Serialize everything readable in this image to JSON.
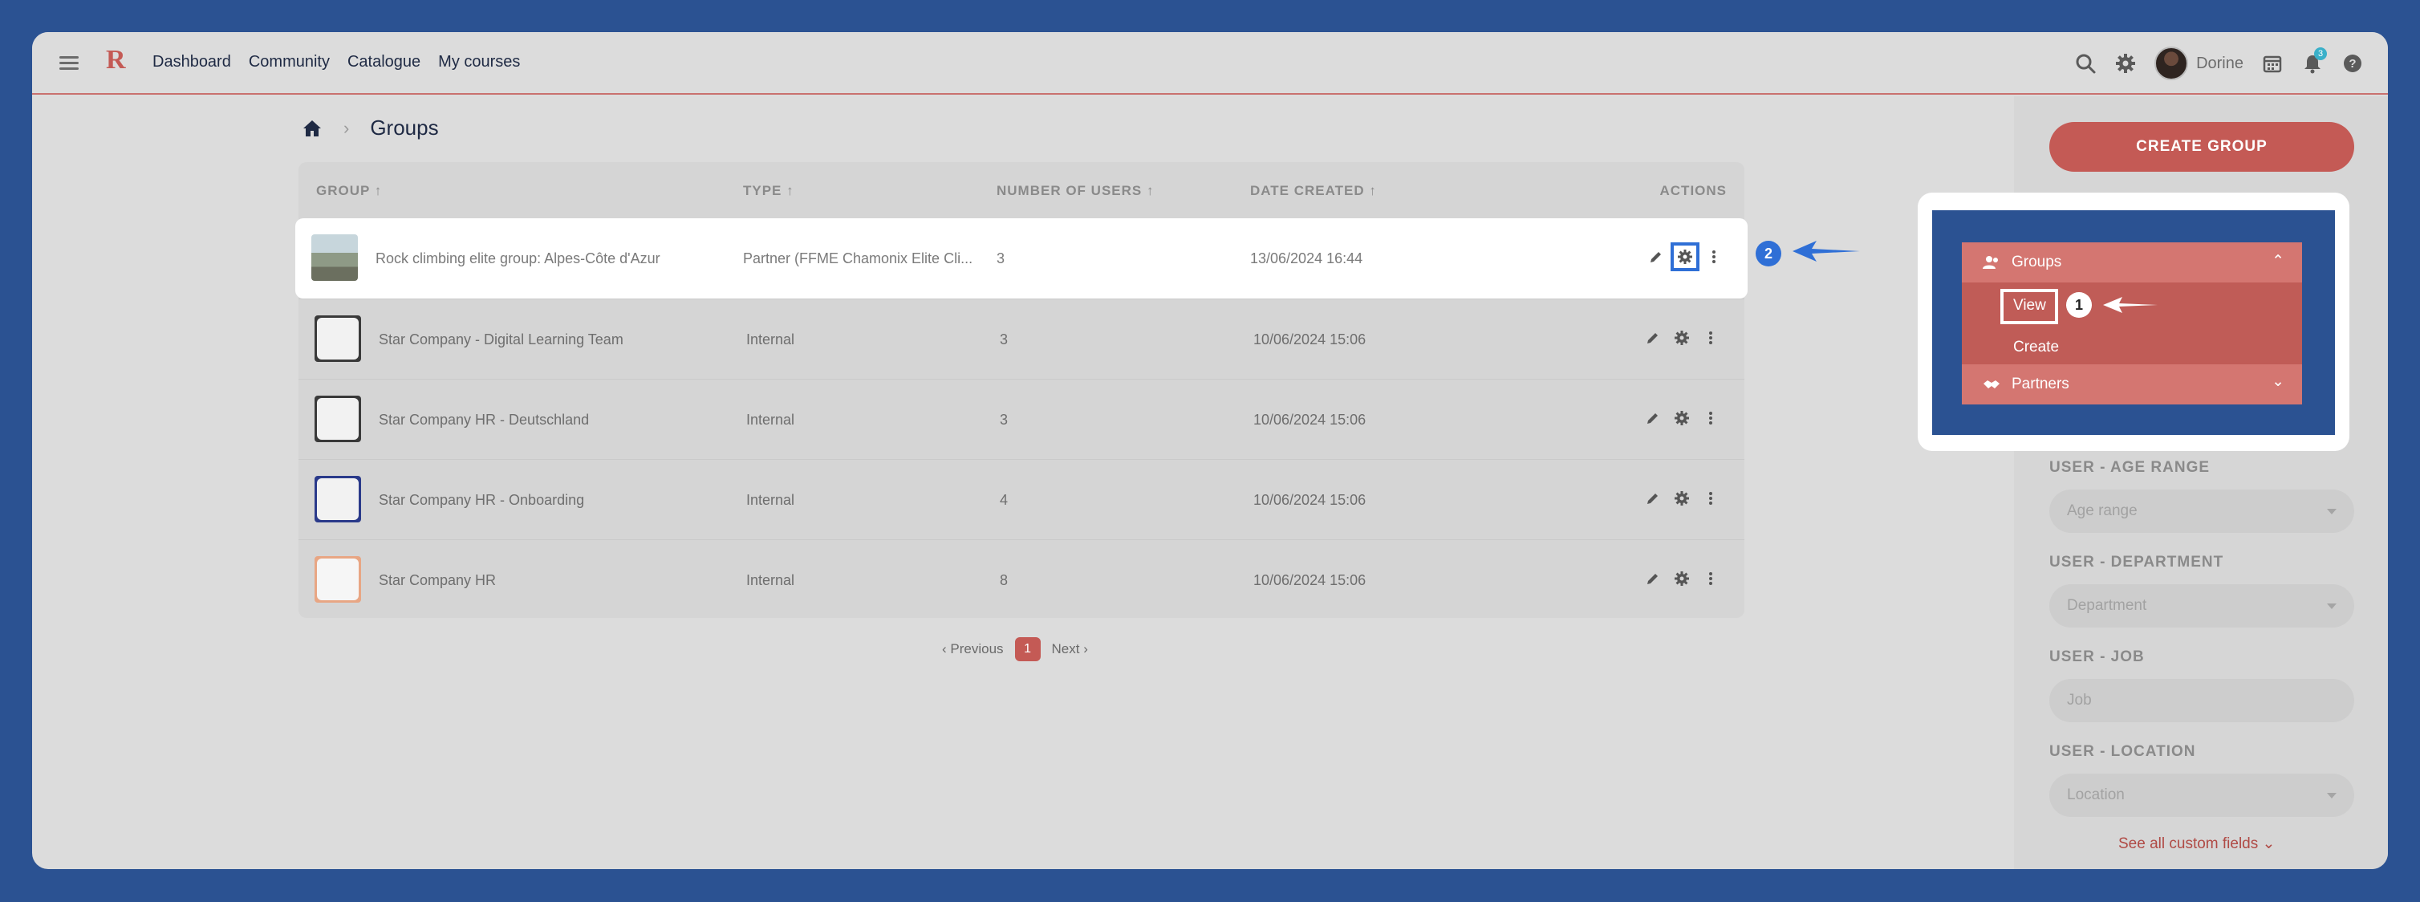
{
  "nav": {
    "logo": "R",
    "links": [
      "Dashboard",
      "Community",
      "Catalogue",
      "My courses"
    ],
    "username": "Dorine",
    "notification_count": "3"
  },
  "breadcrumb": {
    "title": "Groups"
  },
  "table": {
    "headers": {
      "group": "GROUP",
      "type": "TYPE",
      "users": "NUMBER OF USERS",
      "date": "DATE CREATED",
      "actions": "ACTIONS"
    },
    "rows": [
      {
        "group": "Rock climbing elite group: Alpes-Côte d'Azur",
        "type": "Partner (FFME Chamonix Elite Cli...",
        "users": "3",
        "date": "13/06/2024 16:44"
      },
      {
        "group": "Star Company - Digital Learning Team",
        "type": "Internal",
        "users": "3",
        "date": "10/06/2024 15:06"
      },
      {
        "group": "Star Company HR - Deutschland",
        "type": "Internal",
        "users": "3",
        "date": "10/06/2024 15:06"
      },
      {
        "group": "Star Company HR - Onboarding",
        "type": "Internal",
        "users": "4",
        "date": "10/06/2024 15:06"
      },
      {
        "group": "Star Company HR",
        "type": "Internal",
        "users": "8",
        "date": "10/06/2024 15:06"
      }
    ]
  },
  "pagination": {
    "previous": "Previous",
    "current": "1",
    "next": "Next"
  },
  "side": {
    "create_button": "CREATE GROUP",
    "fields": [
      {
        "label": "USER - AGE RANGE",
        "placeholder": "Age range"
      },
      {
        "label": "USER - DEPARTMENT",
        "placeholder": "Department"
      },
      {
        "label": "USER - JOB",
        "placeholder": "Job"
      },
      {
        "label": "USER - LOCATION",
        "placeholder": "Location"
      }
    ],
    "see_all": "See all custom fields"
  },
  "callout": {
    "groups": "Groups",
    "view": "View",
    "create": "Create",
    "partners": "Partners",
    "step1": "1",
    "step2": "2"
  },
  "colors": {
    "brand": "#c45a55",
    "annotation": "#2f6fd6",
    "background": "#2b5292"
  }
}
